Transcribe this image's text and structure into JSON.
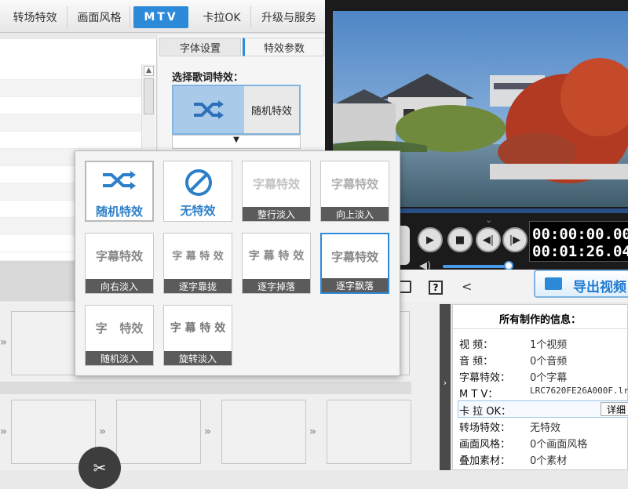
{
  "tabs": [
    "转场特效",
    "画面风格",
    "MTV",
    "卡拉OK",
    "升级与服务"
  ],
  "subtabs": [
    "字体设置",
    "特效参数"
  ],
  "settings": {
    "label": "选择歌词特效：",
    "current": "随机特效",
    "dropdown_arrow": "▼"
  },
  "effects": [
    {
      "name": "随机特效",
      "preview": "",
      "icon": "shuffle-icon"
    },
    {
      "name": "无特效",
      "preview": "",
      "icon": "no-effect-icon"
    },
    {
      "name": "整行淡入",
      "preview": "字幕特效"
    },
    {
      "name": "向上淡入",
      "preview": "字幕特效"
    },
    {
      "name": "向右淡入",
      "preview": "字幕特效"
    },
    {
      "name": "逐字靠拢",
      "preview": "字 幕 特 效"
    },
    {
      "name": "逐字掉落",
      "preview": "字 幕 特 效"
    },
    {
      "name": "逐字飘落",
      "preview": "字幕特效",
      "selected": true
    },
    {
      "name": "随机淡入",
      "preview": "字   特效"
    },
    {
      "name": "旋转淡入",
      "preview": "字 幕 特 效"
    }
  ],
  "player": {
    "time_current": "00:00:00.00",
    "time_total": "00:01:26.04",
    "progress": 0.0,
    "volume": 0.8
  },
  "export_label": "导出视频",
  "info": {
    "title": "所有制作的信息：",
    "rows": [
      {
        "label": "视    频：",
        "value": "1个视频"
      },
      {
        "label": "音    频：",
        "value": "0个音频"
      },
      {
        "label": "字幕特效：",
        "value": "0个字幕"
      },
      {
        "label": "M  T  V：",
        "value": "LRC7620FE26A000F.lr"
      },
      {
        "label": "卡 拉 OK：",
        "value": "",
        "button": "详细"
      },
      {
        "label": "转场特效：",
        "value": "无特效"
      },
      {
        "label": "画面风格：",
        "value": "0个画面风格"
      },
      {
        "label": "叠加素材：",
        "value": "0个素材"
      }
    ]
  },
  "colors": {
    "accent": "#2d8ad8",
    "caption_bg": "#5b5b5b"
  }
}
